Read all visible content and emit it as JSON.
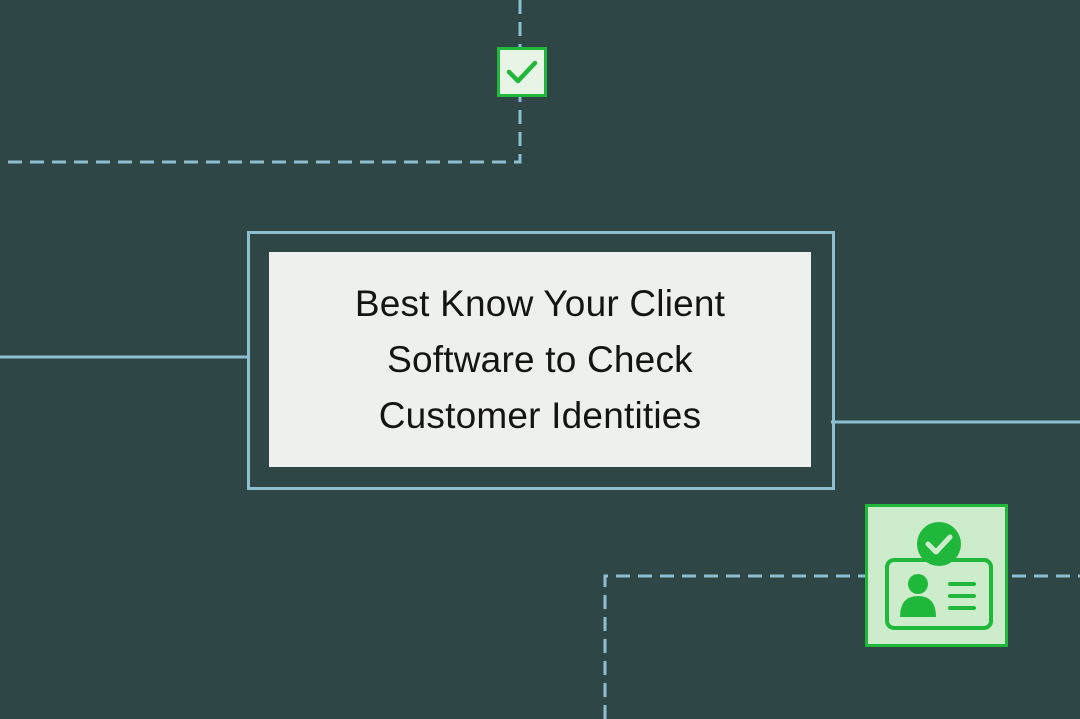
{
  "title": {
    "lines": [
      "Best Know Your Client",
      "Software to Check",
      "Customer Identities"
    ]
  },
  "icons": {
    "top": "checkbox-checked-icon",
    "bottom": "id-card-verified-icon"
  },
  "colors": {
    "background": "#2f4647",
    "line": "#8dbfd1",
    "card": "#eef0ed",
    "accent_green": "#1fb83a",
    "icon_fill": "#cdeccb"
  }
}
